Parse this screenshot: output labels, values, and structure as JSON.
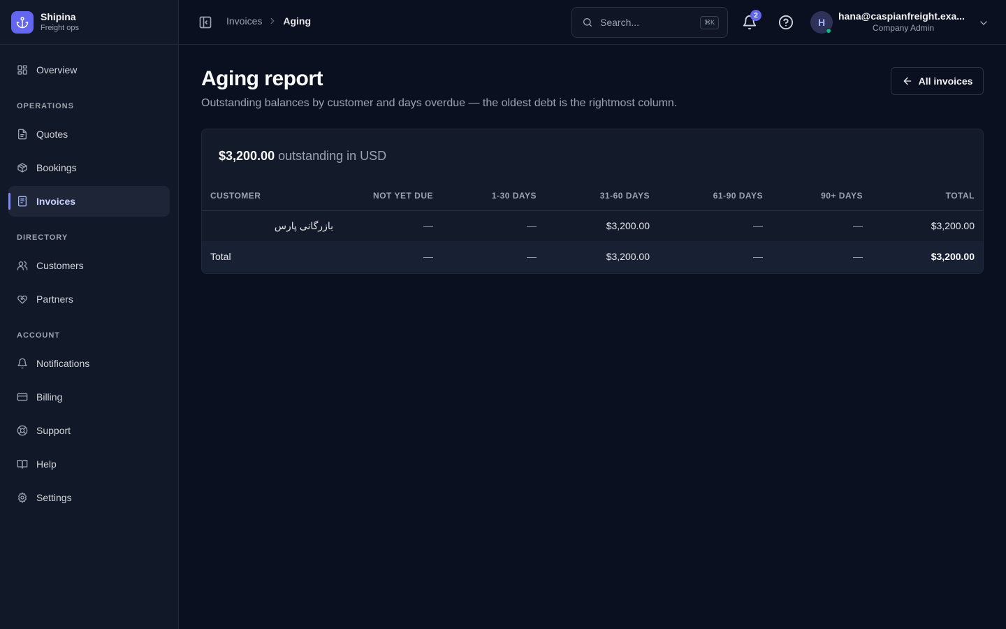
{
  "brand": {
    "name": "Shipina",
    "subtitle": "Freight ops"
  },
  "nav": {
    "overview": "Overview",
    "sections": {
      "operations": "OPERATIONS",
      "directory": "DIRECTORY",
      "account": "ACCOUNT"
    },
    "quotes": "Quotes",
    "bookings": "Bookings",
    "invoices": "Invoices",
    "customers": "Customers",
    "partners": "Partners",
    "notifications": "Notifications",
    "billing": "Billing",
    "support": "Support",
    "help": "Help",
    "settings": "Settings",
    "active": "invoices"
  },
  "breadcrumb": {
    "parent": "Invoices",
    "current": "Aging"
  },
  "search": {
    "placeholder": "Search...",
    "shortcut": "⌘K"
  },
  "notifications": {
    "count": "2"
  },
  "user": {
    "initial": "H",
    "email": "hana@caspianfreight.exa...",
    "role": "Company Admin"
  },
  "page": {
    "title": "Aging report",
    "description": "Outstanding balances by customer and days overdue — the oldest debt is the rightmost column.",
    "back_label": "All invoices"
  },
  "summary": {
    "amount": "$3,200.00",
    "text": "outstanding in USD"
  },
  "table": {
    "headers": [
      "CUSTOMER",
      "NOT YET DUE",
      "1-30 DAYS",
      "31-60 DAYS",
      "61-90 DAYS",
      "90+ DAYS",
      "TOTAL"
    ],
    "rows": [
      {
        "customer": "بازرگانی پارس",
        "not_yet_due": "—",
        "d1_30": "—",
        "d31_60": "$3,200.00",
        "d61_90": "—",
        "d90_plus": "—",
        "total": "$3,200.00"
      }
    ],
    "totals": {
      "label": "Total",
      "not_yet_due": "—",
      "d1_30": "—",
      "d31_60": "$3,200.00",
      "d61_90": "—",
      "d90_plus": "—",
      "total": "$3,200.00"
    }
  },
  "colors": {
    "accent": "#6366f1",
    "background": "#0b1020",
    "sidebar": "#111827",
    "online": "#10b981"
  }
}
